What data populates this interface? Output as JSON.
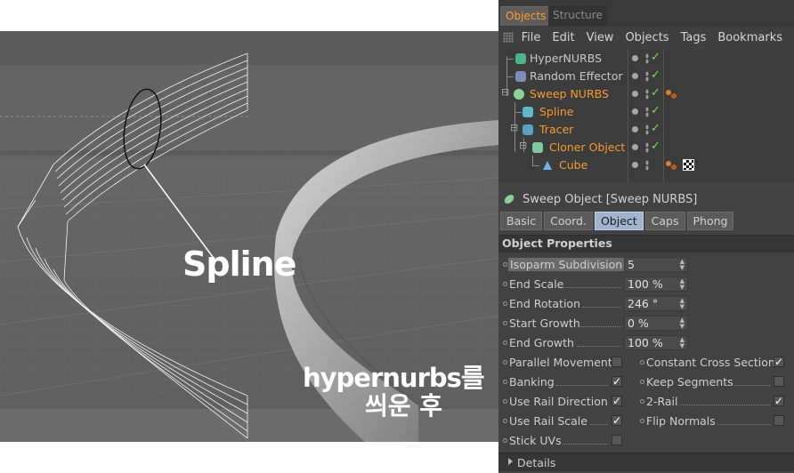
{
  "viewport": {
    "spline_label": "Spline",
    "caption_line1": "hypernurbs를",
    "caption_line2": "씌운 후"
  },
  "panel": {
    "top_tabs": [
      {
        "label": "Objects",
        "active": true
      },
      {
        "label": "Structure",
        "active": false
      }
    ],
    "menu": [
      "File",
      "Edit",
      "View",
      "Objects",
      "Tags",
      "Bookmarks"
    ],
    "tree": [
      {
        "name": "HyperNURBS",
        "selected": false,
        "icon": "hypernurbs-icon"
      },
      {
        "name": "Random Effector",
        "selected": false,
        "icon": "random-effector-icon"
      },
      {
        "name": "Sweep NURBS",
        "selected": true,
        "icon": "sweep-nurbs-icon"
      },
      {
        "name": "Spline",
        "selected": true,
        "icon": "spline-icon"
      },
      {
        "name": "Tracer",
        "selected": true,
        "icon": "tracer-icon"
      },
      {
        "name": "Cloner Object",
        "selected": true,
        "icon": "cloner-icon"
      },
      {
        "name": "Cube",
        "selected": true,
        "icon": "cube-icon"
      }
    ],
    "attr_title": "Sweep Object [Sweep NURBS]",
    "attr_tabs": [
      {
        "label": "Basic",
        "active": false
      },
      {
        "label": "Coord.",
        "active": false
      },
      {
        "label": "Object",
        "active": true
      },
      {
        "label": "Caps",
        "active": false
      },
      {
        "label": "Phong",
        "active": false
      }
    ],
    "section_title": "Object Properties",
    "fields": [
      {
        "label": "Isoparm Subdivision",
        "value": "5"
      },
      {
        "label": "End Scale",
        "value": "100 %"
      },
      {
        "label": "End Rotation",
        "value": "246 °"
      },
      {
        "label": "Start Growth",
        "value": "0 %"
      },
      {
        "label": "End Growth",
        "value": "100 %"
      }
    ],
    "checks_left": [
      {
        "label": "Parallel Movement",
        "checked": false
      },
      {
        "label": "Banking",
        "checked": true
      },
      {
        "label": "Use Rail Direction",
        "checked": true
      },
      {
        "label": "Use Rail Scale",
        "checked": true
      },
      {
        "label": "Stick UVs",
        "checked": false
      }
    ],
    "checks_right": [
      {
        "label": "Constant Cross Section",
        "checked": true
      },
      {
        "label": "Keep Segments",
        "checked": false
      },
      {
        "label": "2-Rail",
        "checked": true
      },
      {
        "label": "Flip Normals",
        "checked": false
      }
    ],
    "details_label": "Details",
    "colors": {
      "selected_orange": "#f49b2d",
      "check_green": "#7ddc4a",
      "active_tab_blue": "#a0b4cf"
    }
  }
}
